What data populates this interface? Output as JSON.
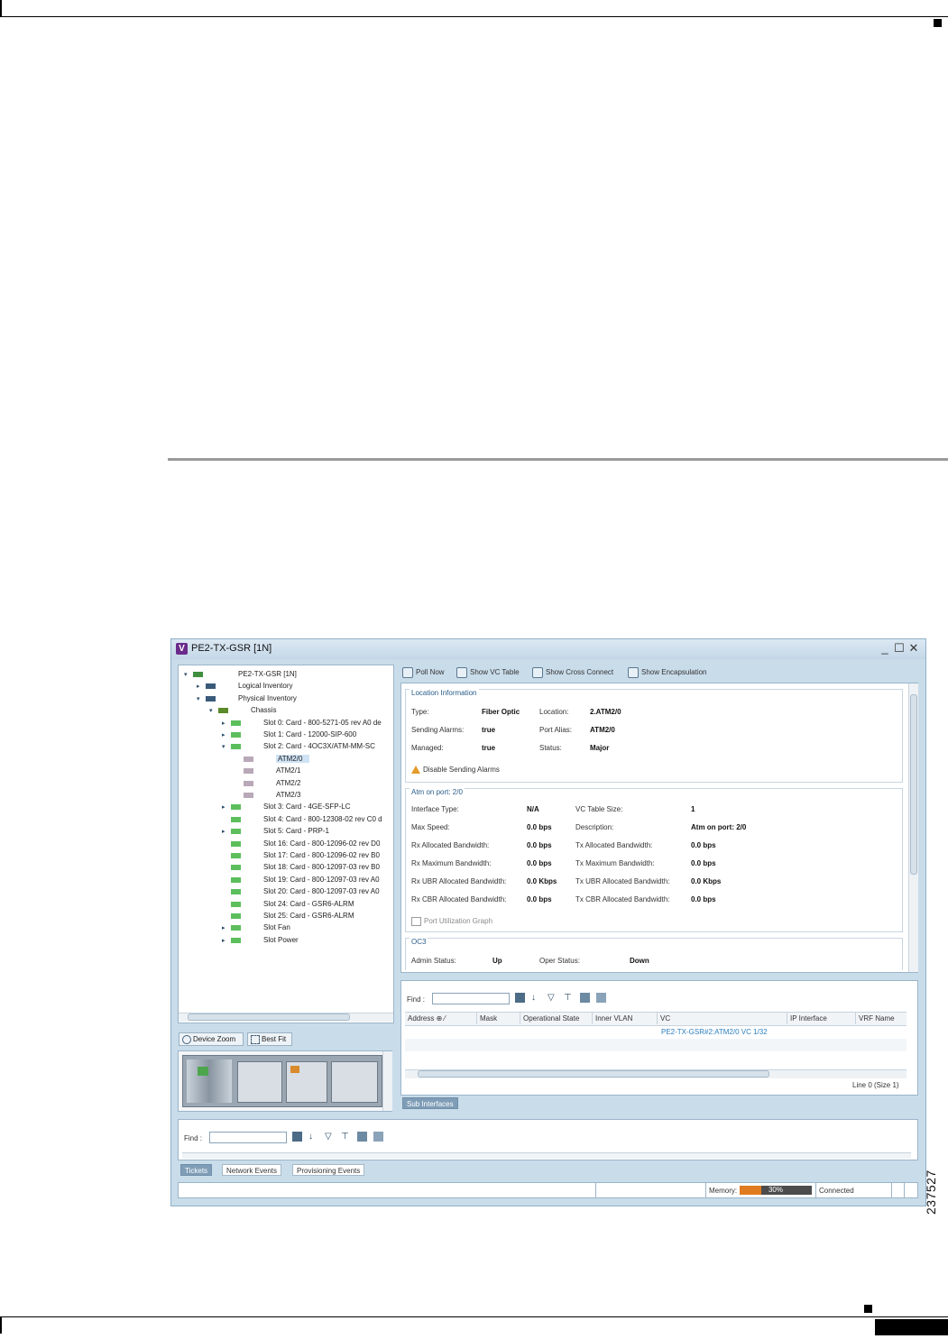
{
  "figure": {
    "number": "237527"
  },
  "window": {
    "title": "PE2-TX-GSR [1N]",
    "app_icon_letter": "V",
    "controls": {
      "minimize": "_",
      "maximize": "☐",
      "close": "✕"
    }
  },
  "tree": {
    "items": [
      {
        "label": "PE2-TX-GSR [1N]",
        "icon": "device-icon",
        "expanded": true
      },
      {
        "label": "Logical Inventory",
        "icon": "logical-inventory-icon",
        "expanded": false
      },
      {
        "label": "Physical Inventory",
        "icon": "physical-inventory-icon",
        "expanded": true
      },
      {
        "label": "Chassis",
        "icon": "chassis-icon",
        "expanded": true
      },
      {
        "label": "Slot 0: Card - 800-5271-05 rev A0 de",
        "icon": "card-icon",
        "expanded": false
      },
      {
        "label": "Slot 1: Card - 12000-SIP-600",
        "icon": "card-icon",
        "expanded": false
      },
      {
        "label": "Slot 2: Card - 4OC3X/ATM-MM-SC",
        "icon": "card-icon",
        "expanded": true
      },
      {
        "label": "ATM2/0",
        "icon": "port-icon",
        "selected": true
      },
      {
        "label": "ATM2/1",
        "icon": "port-icon"
      },
      {
        "label": "ATM2/2",
        "icon": "port-icon"
      },
      {
        "label": "ATM2/3",
        "icon": "port-icon"
      },
      {
        "label": "Slot 3: Card - 4GE-SFP-LC",
        "icon": "card-icon",
        "expanded": false
      },
      {
        "label": "Slot 4: Card - 800-12308-02 rev C0 d",
        "icon": "card-icon"
      },
      {
        "label": "Slot 5: Card - PRP-1",
        "icon": "card-icon",
        "expanded": false
      },
      {
        "label": "Slot 16: Card - 800-12096-02 rev D0",
        "icon": "card-icon"
      },
      {
        "label": "Slot 17: Card - 800-12096-02 rev B0",
        "icon": "card-icon"
      },
      {
        "label": "Slot 18: Card - 800-12097-03 rev B0",
        "icon": "card-icon"
      },
      {
        "label": "Slot 19: Card - 800-12097-03 rev A0",
        "icon": "card-icon"
      },
      {
        "label": "Slot 20: Card - 800-12097-03 rev A0",
        "icon": "card-icon"
      },
      {
        "label": "Slot 24: Card - GSR6-ALRM",
        "icon": "card-icon"
      },
      {
        "label": "Slot 25: Card - GSR6-ALRM",
        "icon": "card-icon"
      },
      {
        "label": "Slot Fan",
        "icon": "card-icon",
        "expanded": false
      },
      {
        "label": "Slot Power",
        "icon": "card-icon",
        "expanded": false
      }
    ]
  },
  "map": {
    "device_zoom": "Device Zoom",
    "best_fit": "Best Fit"
  },
  "toolbar": {
    "poll_now": "Poll Now",
    "show_vc_table": "Show VC Table",
    "show_cross_connect": "Show Cross Connect",
    "show_encapsulation": "Show Encapsulation"
  },
  "location": {
    "title": "Location Information",
    "type_label": "Type:",
    "type_value": "Fiber Optic",
    "location_label": "Location:",
    "location_value": "2.ATM2/0",
    "sending_alarms_label": "Sending Alarms:",
    "sending_alarms_value": "true",
    "port_alias_label": "Port Alias:",
    "port_alias_value": "ATM2/0",
    "managed_label": "Managed:",
    "managed_value": "true",
    "status_label": "Status:",
    "status_value": "Major",
    "disable_alarms": "Disable Sending Alarms"
  },
  "atm_port": {
    "title": "Atm on port: 2/0",
    "interface_type_label": "Interface Type:",
    "interface_type_value": "N/A",
    "vc_table_size_label": "VC Table Size:",
    "vc_table_size_value": "1",
    "max_speed_label": "Max Speed:",
    "max_speed_value": "0.0 bps",
    "description_label": "Description:",
    "description_value": "Atm on port: 2/0",
    "rx_alloc_label": "Rx Allocated Bandwidth:",
    "rx_alloc_value": "0.0 bps",
    "tx_alloc_label": "Tx Allocated Bandwidth:",
    "tx_alloc_value": "0.0 bps",
    "rx_max_label": "Rx Maximum Bandwidth:",
    "rx_max_value": "0.0 bps",
    "tx_max_label": "Tx Maximum Bandwidth:",
    "tx_max_value": "0.0 bps",
    "rx_ubr_label": "Rx UBR Allocated Bandwidth:",
    "rx_ubr_value": "0.0 Kbps",
    "tx_ubr_label": "Tx UBR Allocated Bandwidth:",
    "tx_ubr_value": "0.0 Kbps",
    "rx_cbr_label": "Rx CBR Allocated Bandwidth:",
    "rx_cbr_value": "0.0 bps",
    "tx_cbr_label": "Tx CBR Allocated Bandwidth:",
    "tx_cbr_value": "0.0 bps",
    "port_util_graph": "Port Utilization Graph"
  },
  "oc3": {
    "title": "OC3",
    "admin_status_label": "Admin Status:",
    "admin_status_value": "Up",
    "oper_status_label": "Oper Status:",
    "oper_status_value": "Down"
  },
  "subif_table": {
    "find_label": "Find :",
    "columns": [
      "Address",
      "Mask",
      "Operational State",
      "Inner VLAN",
      "VC",
      "IP Interface",
      "VRF Name"
    ],
    "rows": [
      {
        "vc": "PE2-TX-GSR#2:ATM2/0 VC 1/32"
      }
    ],
    "status": "Line 0 (Size 1)",
    "tab": "Sub Interfaces"
  },
  "bottom": {
    "find_label": "Find :",
    "tabs": [
      "Tickets",
      "Network Events",
      "Provisioning Events"
    ],
    "active_tab": "Tickets"
  },
  "statusbar": {
    "memory_label": "Memory:",
    "memory_percent": 30,
    "memory_text": "30%",
    "connection": "Connected"
  }
}
